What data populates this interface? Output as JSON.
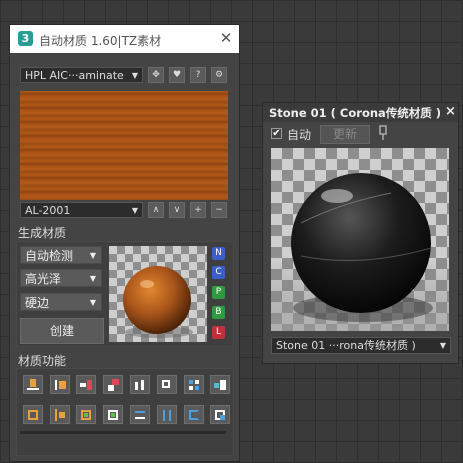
{
  "main_window": {
    "logo": "3",
    "title": "自动材质 1.60|TZ素材",
    "close": "✕",
    "preset_select": "HPL AIC···aminate",
    "toolbar_icons": [
      "move-icon",
      "heart-icon",
      "help-icon",
      "settings-icon"
    ],
    "toolbar_glyphs": [
      "✥",
      "♥",
      "?",
      "⚙"
    ],
    "material_select": "AL-2001",
    "nav_buttons": [
      "∧",
      "∨",
      "+",
      "−"
    ],
    "generate_section": "生成材质",
    "options": [
      "自动检测",
      "高光泽",
      "硬边"
    ],
    "create_button": "创建",
    "badges": [
      {
        "label": "N",
        "color": "#3a5fc8"
      },
      {
        "label": "C",
        "color": "#3a5fc8"
      },
      {
        "label": "P",
        "color": "#2f9a3f"
      },
      {
        "label": "B",
        "color": "#2f9a3f"
      },
      {
        "label": "L",
        "color": "#c0303a"
      }
    ],
    "functions_section": "材质功能"
  },
  "stone_window": {
    "title": "Stone 01 ( Corona传统材质 )",
    "close": "×",
    "auto_label": "自动",
    "auto_checked": true,
    "update_button": "更新",
    "pin_icon": "pin-icon",
    "material_select": "Stone 01  ···rona传统材质 )"
  },
  "colors": {
    "panel_bg": "#444444",
    "wood": "#a8531a",
    "badge_blue": "#3a5fc8",
    "badge_green": "#2f9a3f",
    "badge_red": "#c0303a"
  }
}
